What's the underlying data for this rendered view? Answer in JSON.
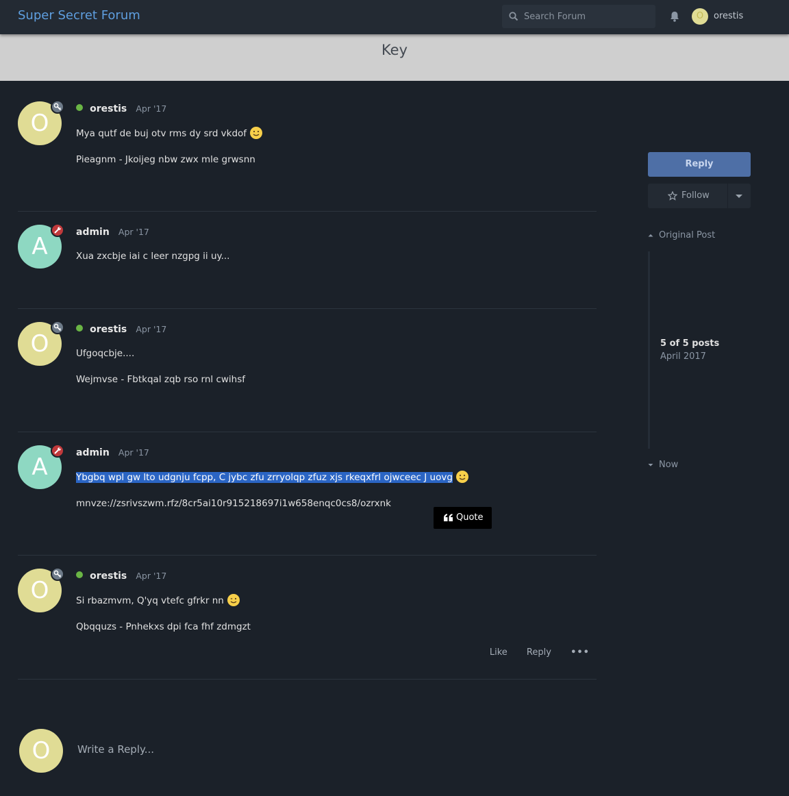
{
  "header": {
    "brand": "Super Secret Forum",
    "search_placeholder": "Search Forum",
    "username": "orestis",
    "user_initial": "O"
  },
  "hero": {
    "title": "Key"
  },
  "posts": [
    {
      "initial": "O",
      "author": "orestis",
      "date": "Apr '17",
      "online": true,
      "lines": [
        "Mya qutf de buj otv rms dy srd vkdof",
        "Pieagnm - Jkoijeg nbw zwx mle grwsnn"
      ]
    },
    {
      "initial": "A",
      "author": "admin",
      "date": "Apr '17",
      "online": false,
      "lines": [
        "Xua zxcbje iai c leer nzgpg ii uy..."
      ]
    },
    {
      "initial": "O",
      "author": "orestis",
      "date": "Apr '17",
      "online": true,
      "lines": [
        "Ufgoqcbje....",
        "Wejmvse - Fbtkqal zqb rso rnl cwihsf"
      ]
    },
    {
      "initial": "A",
      "author": "admin",
      "date": "Apr '17",
      "online": false,
      "lines": [
        "Ybgbq wpl gw lto udgnju fcpp, C jybc zfu zrryolqp zfuz xjs rkeqxfrl ojwceec J uovg",
        "mnvze://zsrivszwm.rfz/8cr5ai10r915218697i1w658enqc0cs8/ozrxnk"
      ]
    },
    {
      "initial": "O",
      "author": "orestis",
      "date": "Apr '17",
      "online": true,
      "lines": [
        "Si rbazmvm, Q'yq vtefc gfrkr nn",
        "Qbqquzs - Pnhekxs dpi fca fhf zdmgzt"
      ]
    }
  ],
  "quote_button": "Quote",
  "post_actions": {
    "like": "Like",
    "reply": "Reply",
    "more": "•••"
  },
  "sidebar": {
    "reply": "Reply",
    "follow": "Follow",
    "original_post": "Original Post",
    "count": "5 of 5 posts",
    "date": "April 2017",
    "now": "Now"
  },
  "composer": {
    "initial": "O",
    "placeholder": "Write a Reply..."
  },
  "colors": {
    "background": "#1b2129",
    "header": "#232a33",
    "brand": "#5f9fe0",
    "avatar_o": "#e0dc95",
    "avatar_a": "#8ed8c2",
    "online": "#6ab545",
    "admin_badge": "#c0393b",
    "highlight": "#2b65c4",
    "reply_button": "#4e6fa6"
  },
  "icons": [
    "search-icon",
    "bell-icon",
    "key-icon",
    "wrench-icon",
    "smile-emoji-icon",
    "wink-emoji-icon",
    "quote-icon",
    "star-icon",
    "chevron-down-icon",
    "double-chevron-up-icon",
    "double-chevron-down-icon"
  ]
}
